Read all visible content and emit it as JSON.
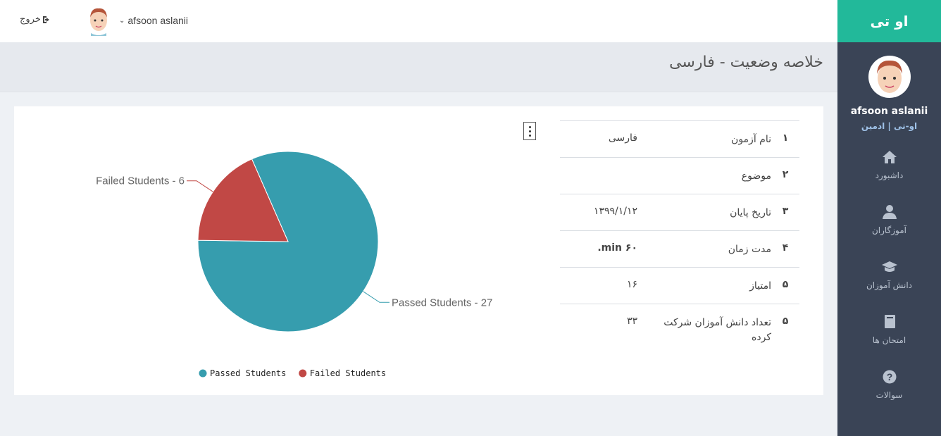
{
  "topbar": {
    "logout_label": "خروج",
    "username": "afsoon aslanii"
  },
  "sidebar": {
    "brand": "او تی",
    "profile_name": "afsoon aslanii",
    "profile_role": "او-تی | ادمین",
    "items": [
      {
        "label": "داشبورد",
        "icon": "home-icon"
      },
      {
        "label": "آموزگاران",
        "icon": "user-icon"
      },
      {
        "label": "دانش آموزان",
        "icon": "graduation-cap-icon"
      },
      {
        "label": "امتحان ها",
        "icon": "book-icon"
      },
      {
        "label": "سوالات",
        "icon": "question-circle-icon"
      }
    ]
  },
  "page": {
    "title": "خلاصه وضعیت - فارسی"
  },
  "info_table": [
    {
      "index": "۱",
      "key": "نام آزمون",
      "value": "فارسی"
    },
    {
      "index": "۲",
      "key": "موضوع",
      "value": ""
    },
    {
      "index": "۳",
      "key": "تاریخ پایان",
      "value": "۱۳۹۹/۱/۱۲"
    },
    {
      "index": "۴",
      "key": "مدت زمان",
      "value": "۶۰ min."
    },
    {
      "index": "۵",
      "key": "امتیاز",
      "value": "۱۶"
    },
    {
      "index": "۵",
      "key": "تعداد دانش آموزان شرکت کرده",
      "value": "۳۳"
    }
  ],
  "chart_data": {
    "type": "pie",
    "series": [
      {
        "name": "Passed Students",
        "value": 27,
        "color": "#369dae",
        "label": "Passed Students - 27"
      },
      {
        "name": "Failed Students",
        "value": 6,
        "color": "#c14845",
        "label": "Failed Students - 6"
      }
    ],
    "legend": [
      "Passed Students",
      "Failed Students"
    ],
    "legend_position": "bottom"
  }
}
